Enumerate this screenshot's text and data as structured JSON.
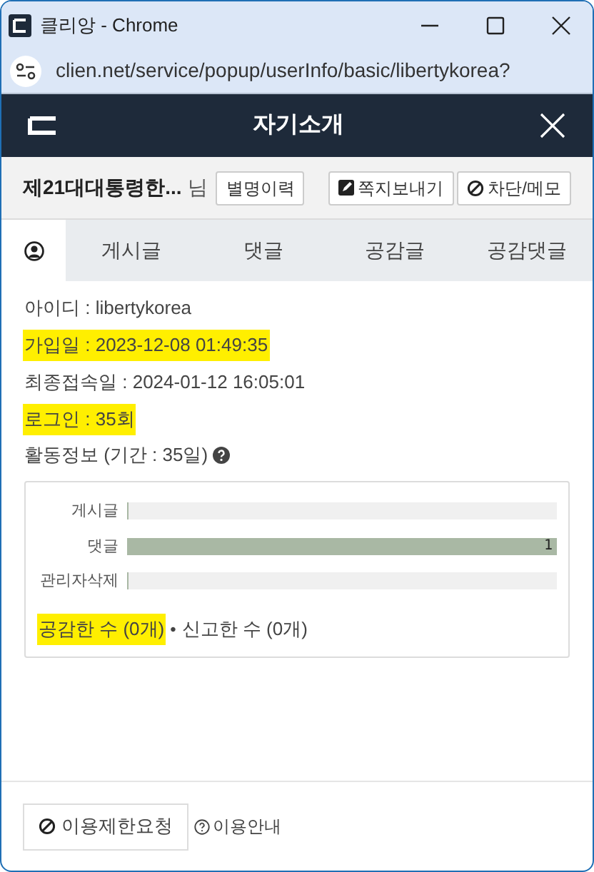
{
  "window": {
    "title": "클리앙 - Chrome"
  },
  "address_bar": {
    "url": "clien.net/service/popup/userInfo/basic/libertykorea?"
  },
  "header": {
    "title": "자기소개"
  },
  "user": {
    "nickname": "제21대대통령한...",
    "suffix": "님",
    "buttons": [
      {
        "label": "별명이력",
        "kind": "plain"
      },
      {
        "label": "쪽지보내기",
        "kind": "message"
      },
      {
        "label": "차단/메모",
        "kind": "block"
      }
    ]
  },
  "tabs": [
    {
      "kind": "profile",
      "selected": true
    },
    {
      "label": "게시글",
      "kind": "text",
      "selected": false
    },
    {
      "label": "댓글",
      "kind": "text",
      "selected": false
    },
    {
      "label": "공감글",
      "kind": "text",
      "selected": false
    },
    {
      "label": "공감댓글",
      "kind": "text",
      "selected": false
    }
  ],
  "info": [
    {
      "text": "아이디 : libertykorea",
      "highlighted": false
    },
    {
      "text": "가입일 : 2023-12-08 01:49:35",
      "highlighted": true
    },
    {
      "text": "최종접속일 : 2024-01-12 16:05:01",
      "highlighted": false
    },
    {
      "text": "로그인 : 35회",
      "highlighted": true
    }
  ],
  "activity": {
    "title": "활동정보 (기간 : 35일)",
    "bars": [
      {
        "label": "게시글",
        "level": 0
      },
      {
        "label": "댓글",
        "level": 1,
        "value": "1"
      },
      {
        "label": "관리자삭제",
        "level": 0
      }
    ],
    "separator": "•",
    "stats": [
      {
        "text": "공감한 수 (0개)",
        "highlighted": true
      },
      {
        "text": "신고한 수 (0개)",
        "highlighted": false
      }
    ]
  },
  "footer": {
    "buttons": [
      {
        "label": "이용제한요청",
        "kind": "button"
      },
      {
        "label": "이용안내",
        "kind": "link"
      }
    ]
  }
}
